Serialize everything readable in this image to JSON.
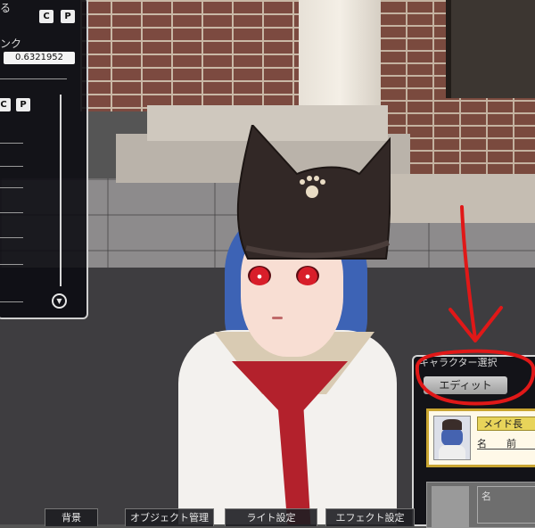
{
  "left_panel": {
    "label_top": "る",
    "label_slider": "ンク",
    "value": "0.6321952",
    "copy_label": "C",
    "paste_label": "P",
    "copy_label_2": "C",
    "paste_label_2": "P",
    "slider_levels": [
      0.2,
      0.4,
      0.5,
      0.3,
      0.6,
      0.4,
      0.7,
      0.5
    ],
    "toggle_icon": "triangle-down"
  },
  "right_panel": {
    "title": "キャラクター選択",
    "edit_button": "エディット",
    "character_card": {
      "badge": "メイド長",
      "name_label": "名　　前"
    },
    "second_card_label": "名"
  },
  "bottom_tabs": [
    "背景",
    "オブジェクト管理",
    "ライト設定",
    "エフェクト設定"
  ],
  "colors": {
    "annotation_red": "#e01818",
    "badge_gold": "#e8d45a",
    "card_border": "#c9a531"
  }
}
